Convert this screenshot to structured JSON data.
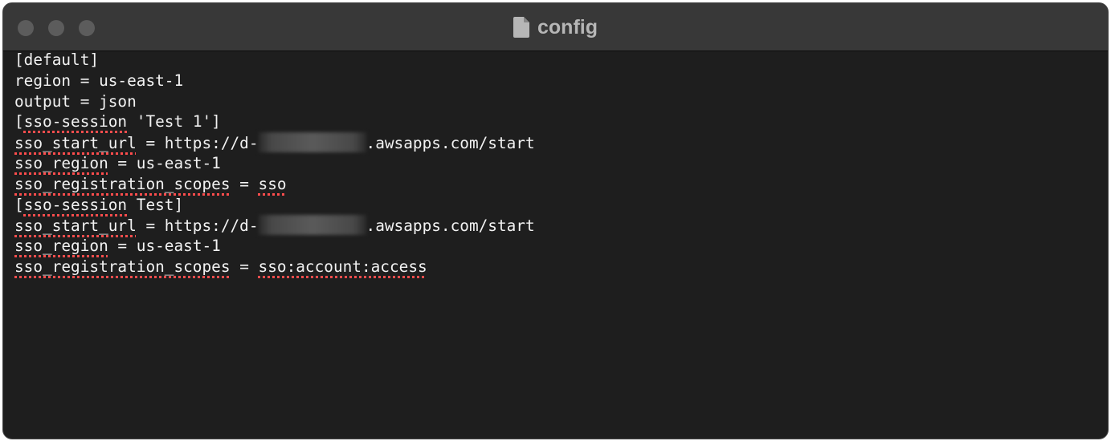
{
  "window": {
    "title": "config",
    "title_icon": "document-icon",
    "traffic_lights": [
      "close-button",
      "minimize-button",
      "zoom-button"
    ],
    "traffic_light_color": "#5c5c5c"
  },
  "editor": {
    "background": "#1e1e1e",
    "text_color": "#f2f2f2",
    "spellcheck_color": "#ff4d4d",
    "lines": [
      {
        "text": "[default]"
      },
      {
        "text": "region = us-east-1"
      },
      {
        "text": "output = json"
      },
      {
        "pre": "[",
        "sp1": "sso-session",
        "post": " 'Test 1']"
      },
      {
        "sp1": "sso_start_url",
        "mid": " = https://d-",
        "post": ".awsapps.com/start"
      },
      {
        "sp1": "sso_region",
        "post": " = us-east-1"
      },
      {
        "sp1": "sso_registration_scopes",
        "mid": " = ",
        "sp2": "sso"
      },
      {
        "pre": "[",
        "sp1": "sso-session",
        "post": " Test]"
      },
      {
        "sp1": "sso_start_url",
        "mid": " = https://d-",
        "post": ".awsapps.com/start"
      },
      {
        "sp1": "sso_region",
        "post": " = us-east-1"
      },
      {
        "sp1": "sso_registration_scopes",
        "mid": " = ",
        "sp2": "sso:account:access"
      }
    ]
  }
}
